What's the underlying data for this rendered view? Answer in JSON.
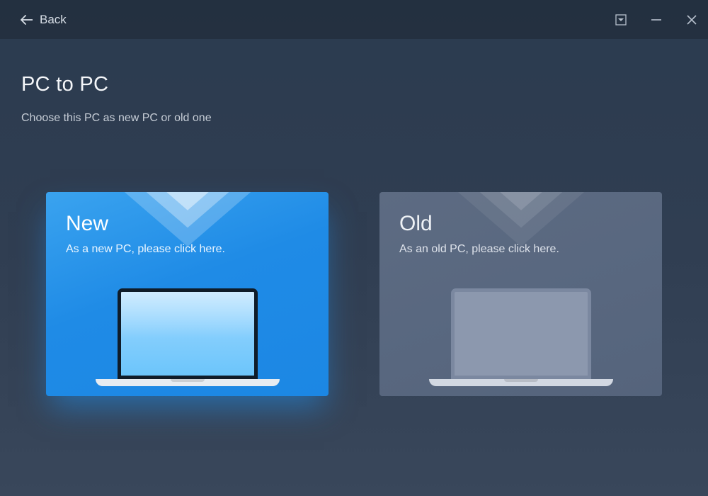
{
  "window": {
    "back_label": "Back"
  },
  "header": {
    "title": "PC to PC",
    "subtitle": "Choose this PC as new PC or old one"
  },
  "cards": {
    "new": {
      "title": "New",
      "desc": "As a new PC, please click here."
    },
    "old": {
      "title": "Old",
      "desc": "As an old PC, please click here."
    }
  }
}
